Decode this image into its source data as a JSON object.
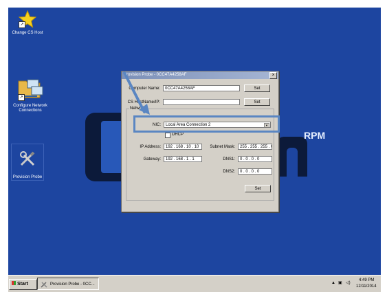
{
  "desktop": {
    "logo_text": "RPM",
    "icons": [
      {
        "label": "Change CS Host",
        "icon": "star-icon"
      },
      {
        "label": "Configure Network Connections",
        "icon": "network-folder-icon"
      },
      {
        "label": "Provision Probe",
        "icon": "tools-icon"
      }
    ]
  },
  "dialog": {
    "title": "Provision Probe - 0CC47A4258AF",
    "computer_name_label": "Computer Name:",
    "computer_name_value": "0CC47A4258AF",
    "set_label": "Set",
    "cs_host_label": "CS HostName/IP:",
    "cs_host_value": "",
    "network_group_label": "Network",
    "nic_label": "NIC:",
    "nic_value": "Local Area Connection 2",
    "dhcp_label": "DHCP",
    "ip_label": "IP Address:",
    "ip_value": "192 . 168 . 10 . 10",
    "gateway_label": "Gateway:",
    "gateway_value": "192 . 168 . 1 . 1",
    "subnet_label": "Subnet Mask:",
    "subnet_value": "255 . 255 . 255 . 0",
    "dns1_label": "DNS1:",
    "dns1_value": "0 . 0 . 0 . 0",
    "dns2_label": "DNS2:",
    "dns2_value": "0 . 0 . 0 . 0"
  },
  "taskbar": {
    "start_label": "Start",
    "task_label": "Provision Probe - 0CC...",
    "time": "4:49 PM",
    "date": "12/11/2014"
  },
  "colors": {
    "desktop_bg": "#1d45a0",
    "highlight": "#5a86c2",
    "dialog_bg": "#d4d0c8"
  }
}
